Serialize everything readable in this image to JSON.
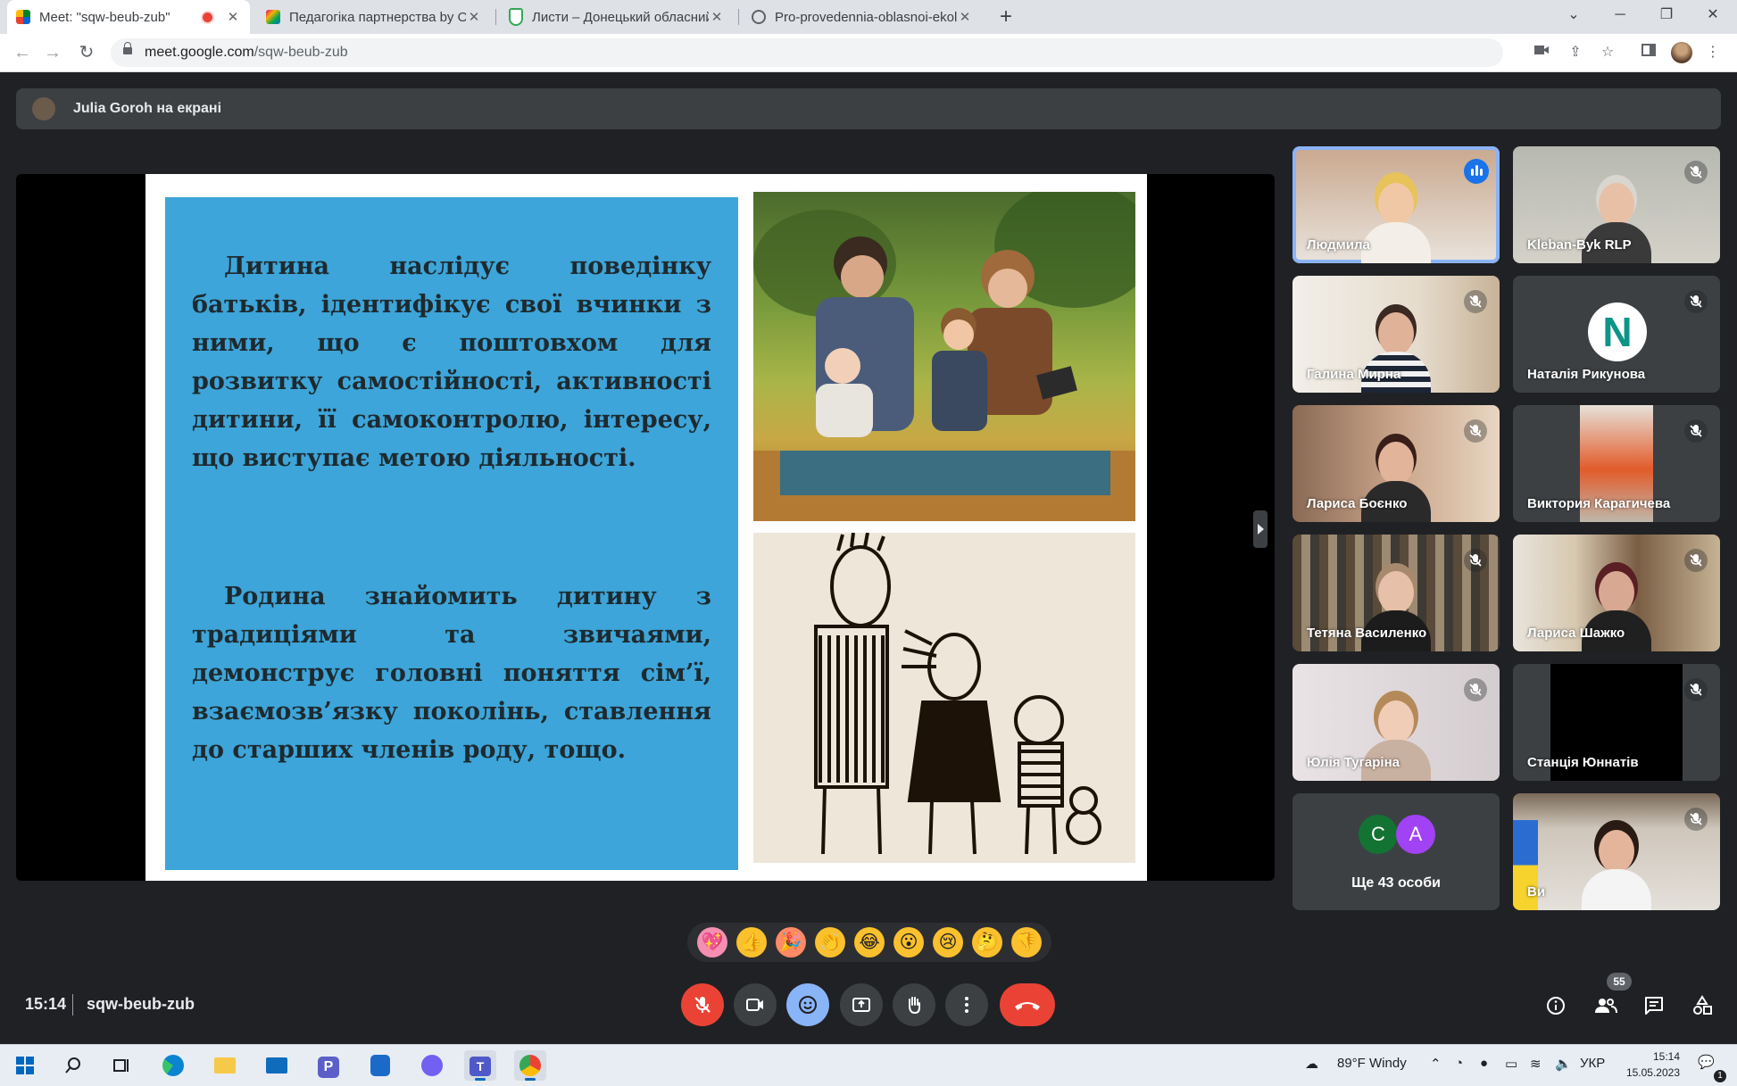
{
  "browser": {
    "tabs": [
      {
        "title": "Meet: \"sqw-beub-zub\"",
        "active": true,
        "recording": true
      },
      {
        "title": "Педагогіка партнерства by Оле",
        "active": false
      },
      {
        "title": "Листи – Донецький обласний ",
        "active": false
      },
      {
        "title": "Pro-provedennia-oblasnoi-ekolo",
        "active": false
      }
    ],
    "url_host": "meet.google.com",
    "url_path": "/sqw-beub-zub"
  },
  "meet": {
    "presenter_text": "Julia Goroh на екрані",
    "slide": {
      "paragraph1": "Дитина наслідує поведінку батьків, ідентифікує свої вчинки з ними, що є поштовхом для розвитку самостійності, активності дитини, її самоконтролю, інтересу, що виступає метою діяльності.",
      "paragraph2": "Родина знайомить дитину з традиціями та звичаями, демонструє головні поняття сім’ї, взаємозв’язку поколінь, ставлення до старших членів роду, тощо."
    },
    "participants": [
      {
        "name": "Людмила",
        "status": "speaking"
      },
      {
        "name": "Kleban-Byk RLP",
        "status": "muted"
      },
      {
        "name": "Галина Мирна",
        "status": "muted"
      },
      {
        "name": "Наталія Рикунова",
        "status": "muted",
        "avatar_letter": "N"
      },
      {
        "name": "Лариса Боєнко",
        "status": "muted"
      },
      {
        "name": "Виктория Карагичева",
        "status": "muted"
      },
      {
        "name": "Тетяна Василенко",
        "status": "muted"
      },
      {
        "name": "Лариса Шажко",
        "status": "muted"
      },
      {
        "name": "Юлія Тугаріна",
        "status": "muted"
      },
      {
        "name": "Станція Юннатів",
        "status": "muted"
      },
      {
        "name": "Ви",
        "status": "muted"
      }
    ],
    "more": {
      "letters": [
        "C",
        "A"
      ],
      "label": "Ще 43 особи"
    },
    "reactions": [
      "💖",
      "👍",
      "🎉",
      "👏",
      "😂",
      "😮",
      "😢",
      "🤔",
      "👎"
    ],
    "clock": "15:14",
    "meeting_code": "sqw-beub-zub",
    "people_count": "55"
  },
  "taskbar": {
    "weather": "89°F Windy",
    "language": "УКР",
    "time": "15:14",
    "date": "15.05.2023",
    "notification_count": "1"
  },
  "colors": {
    "meet_bg": "#202124",
    "tile_bg": "#3c4043",
    "slide_blue": "#3da5d9",
    "hangup_red": "#ea4335",
    "speaking_blue": "#8ab4f8"
  }
}
